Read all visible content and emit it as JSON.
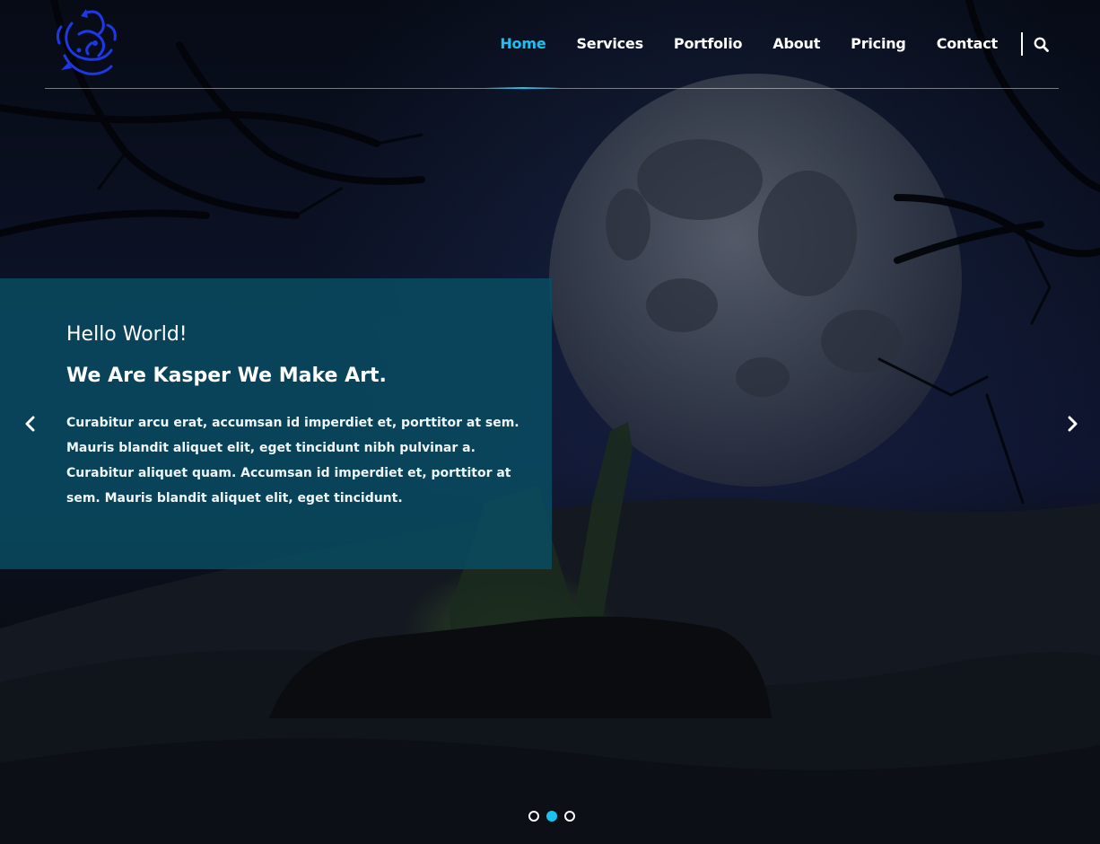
{
  "brand": {
    "logo_icon": "blue-dragon-logo-icon",
    "accent_color": "#19c2f0",
    "panel_color": "#094e64"
  },
  "nav": {
    "items": [
      {
        "label": "Home",
        "active": true
      },
      {
        "label": "Services",
        "active": false
      },
      {
        "label": "Portfolio",
        "active": false
      },
      {
        "label": "About",
        "active": false
      },
      {
        "label": "Pricing",
        "active": false
      },
      {
        "label": "Contact",
        "active": false
      }
    ],
    "search_icon": "search-icon"
  },
  "slide": {
    "heading": "Hello World!",
    "subheading": "We Are Kasper We Make Art.",
    "body": "Curabitur arcu erat, accumsan id imperdiet et, porttitor at sem. Mauris blandit aliquet elit, eget tincidunt nibh pulvinar a. Curabitur aliquet quam. Accumsan id imperdiet et, porttitor at sem. Mauris blandit aliquet elit, eget tincidunt."
  },
  "slider": {
    "prev_icon": "chevron-left-icon",
    "next_icon": "chevron-right-icon",
    "dots": [
      {
        "active": false
      },
      {
        "active": true
      },
      {
        "active": false
      }
    ]
  }
}
